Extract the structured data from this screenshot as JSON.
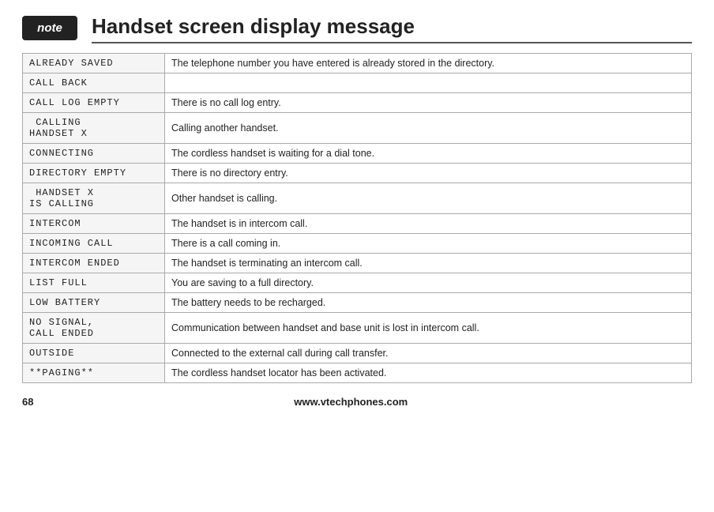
{
  "note_badge": "note",
  "page_title": "Handset screen display message",
  "table": {
    "rows": [
      {
        "display": "ALREADY SAVED",
        "description": "The telephone number you have entered is already stored in the directory."
      },
      {
        "display": "CALL BACK",
        "description": ""
      },
      {
        "display": "CALL LOG EMPTY",
        "description": "There is no call log entry."
      },
      {
        "display": " CALLING\nHANDSET X",
        "description": "Calling another handset."
      },
      {
        "display": "CONNECTING",
        "description": "The cordless handset is waiting for a dial tone."
      },
      {
        "display": "DIRECTORY EMPTY",
        "description": "There is no directory entry."
      },
      {
        "display": " HANDSET X\nIS CALLING",
        "description": "Other handset is calling."
      },
      {
        "display": "INTERCOM",
        "description": "The handset is in intercom call."
      },
      {
        "display": "INCOMING CALL",
        "description": "There is a call coming in."
      },
      {
        "display": "INTERCOM ENDED",
        "description": "The handset is terminating an intercom call."
      },
      {
        "display": "LIST FULL",
        "description": "You are saving to a full directory."
      },
      {
        "display": "LOW BATTERY",
        "description": "The battery needs to be recharged."
      },
      {
        "display": "NO SIGNAL,\nCALL ENDED",
        "description": "Communication between handset and base unit is lost in intercom call."
      },
      {
        "display": "OUTSIDE",
        "description": "Connected to the external call during call transfer."
      },
      {
        "display": "**PAGING**",
        "description": "The cordless handset locator has been activated."
      }
    ]
  },
  "footer": {
    "page_number": "68",
    "website": "www.vtechphones.com"
  }
}
